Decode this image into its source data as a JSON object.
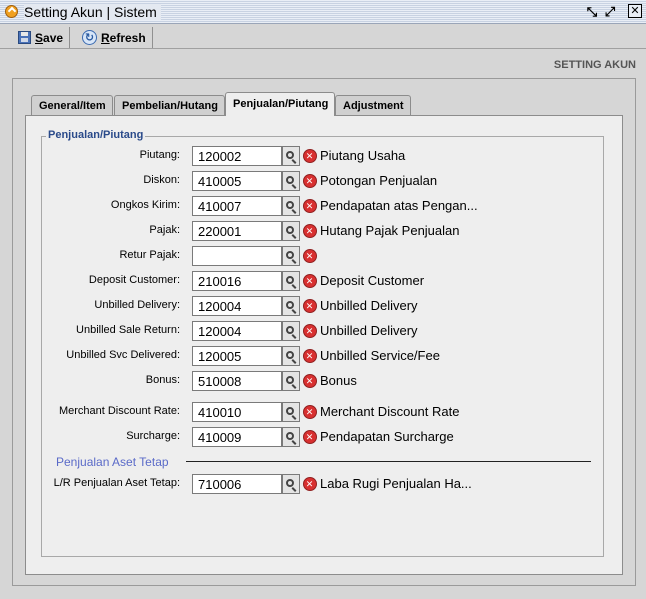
{
  "window": {
    "title": "Setting Akun | Sistem",
    "buttons": {
      "restore": "⤡",
      "maximize": "⤢",
      "close": "✕"
    }
  },
  "toolbar": {
    "save_key": "S",
    "save_rest": "ave",
    "refresh_key": "R",
    "refresh_rest": "efresh"
  },
  "section_heading": "SETTING AKUN",
  "tabs": [
    {
      "label": "General/Item",
      "active": false
    },
    {
      "label": "Pembelian/Hutang",
      "active": false
    },
    {
      "label": "Penjualan/Piutang",
      "active": true
    },
    {
      "label": "Adjustment",
      "active": false
    }
  ],
  "group_label": "Penjualan/Piutang",
  "rows": [
    {
      "label": "Piutang:",
      "code": "120002",
      "desc": "Piutang Usaha"
    },
    {
      "label": "Diskon:",
      "code": "410005",
      "desc": "Potongan Penjualan"
    },
    {
      "label": "Ongkos Kirim:",
      "code": "410007",
      "desc": "Pendapatan atas Pengan..."
    },
    {
      "label": "Pajak:",
      "code": "220001",
      "desc": "Hutang Pajak Penjualan"
    },
    {
      "label": "Retur Pajak:",
      "code": "",
      "desc": ""
    },
    {
      "label": "Deposit Customer:",
      "code": "210016",
      "desc": "Deposit Customer"
    },
    {
      "label": "Unbilled Delivery:",
      "code": "120004",
      "desc": "Unbilled Delivery"
    },
    {
      "label": "Unbilled Sale Return:",
      "code": "120004",
      "desc": "Unbilled Delivery"
    },
    {
      "label": "Unbilled Svc Delivered:",
      "code": "120005",
      "desc": "Unbilled Service/Fee"
    },
    {
      "label": "Bonus:",
      "code": "510008",
      "desc": "Bonus"
    },
    {
      "label": "Merchant Discount Rate:",
      "code": "410010",
      "desc": "Merchant Discount Rate"
    },
    {
      "label": "Surcharge:",
      "code": "410009",
      "desc": "Pendapatan Surcharge"
    }
  ],
  "subgroup": {
    "label": "Penjualan Aset Tetap",
    "rows": [
      {
        "label": "L/R Penjualan Aset Tetap:",
        "code": "710006",
        "desc": "Laba Rugi Penjualan Ha..."
      }
    ]
  },
  "icons": {
    "search": "magnifier-icon",
    "clear": "clear-x-icon",
    "save": "floppy-disk-icon",
    "refresh": "refresh-icon"
  }
}
